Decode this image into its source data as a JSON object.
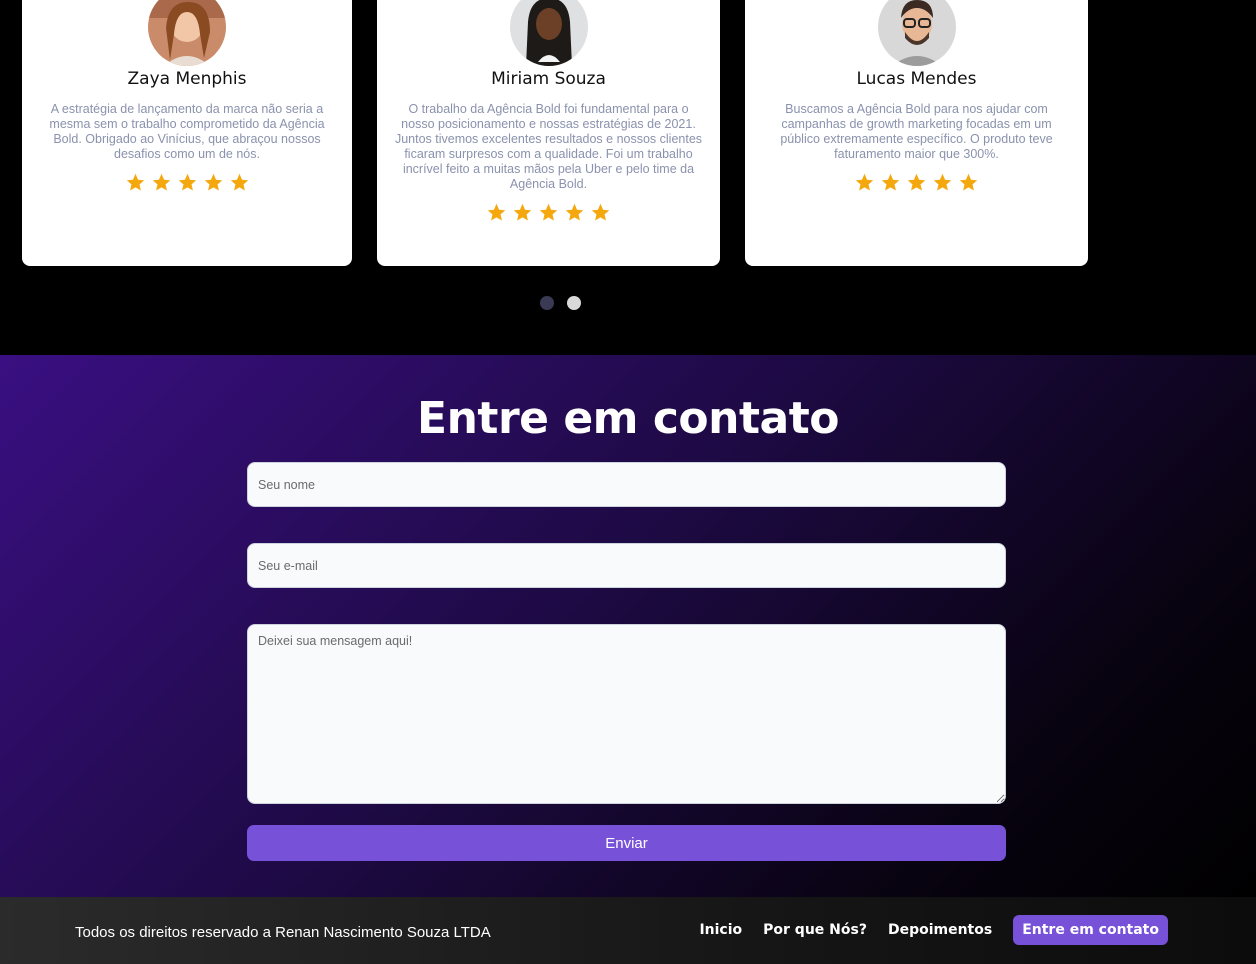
{
  "testimonials": [
    {
      "name": "Zaya Menphis",
      "text": "A estratégia de lançamento da marca não seria a mesma sem o trabalho comprometido da Agência Bold. Obrigado ao Vinícius, que abraçou nossos desafios como um de nós.",
      "rating": 5
    },
    {
      "name": "Miriam Souza",
      "text": "O trabalho da Agência Bold foi fundamental para o nosso posicionamento e nossas estratégias de 2021. Juntos tivemos excelentes resultados e nossos clientes ficaram surpresos com a qualidade. Foi um trabalho incrível feito a muitas mãos pela Uber e pelo time da Agência Bold.",
      "rating": 5
    },
    {
      "name": "Lucas Mendes",
      "text": "Buscamos a Agência Bold para nos ajudar com campanhas de growth marketing focadas em um público extremamente específico. O produto teve faturamento maior que 300%.",
      "rating": 5
    }
  ],
  "carousel": {
    "pages": 2,
    "active": 1
  },
  "contact": {
    "title": "Entre em contato",
    "name_placeholder": "Seu nome",
    "email_placeholder": "Seu e-mail",
    "message_placeholder": "Deixei sua mensagem aqui!",
    "submit_label": "Enviar"
  },
  "footer": {
    "copyright": "Todos os direitos reservado a Renan Nascimento Souza LTDA",
    "nav": [
      "Inicio",
      "Por que Nós?",
      "Depoimentos",
      "Entre em contato"
    ]
  },
  "colors": {
    "accent": "#7752d9",
    "star": "#f5a80e",
    "testimonial_text": "#8a92ad"
  }
}
